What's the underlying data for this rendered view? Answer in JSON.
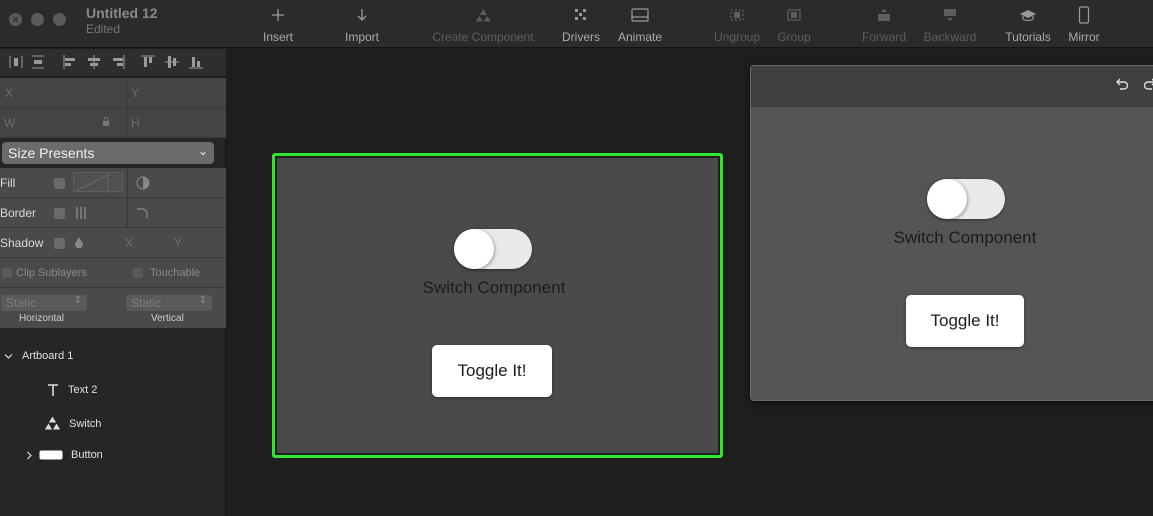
{
  "window": {
    "title": "Untitled 12",
    "status": "Edited"
  },
  "toolbar": {
    "insert": "Insert",
    "import": "Import",
    "create_component": "Create Component",
    "drivers": "Drivers",
    "animate": "Animate",
    "ungroup": "Ungroup",
    "group": "Group",
    "forward": "Forward",
    "backward": "Backward",
    "tutorials": "Tutorials",
    "mirror": "Mirror"
  },
  "inspector": {
    "x_placeholder": "X",
    "y_placeholder": "Y",
    "w_placeholder": "W",
    "h_placeholder": "H",
    "size_presets": "Size Presents",
    "fill_label": "Fill",
    "border_label": "Border",
    "shadow_label": "Shadow",
    "shadow_x": "X",
    "shadow_y": "Y",
    "clip_sublayers": "Clip Sublayers",
    "touchable": "Touchable",
    "horizontal_value": "Static",
    "vertical_value": "Static",
    "horizontal_caption": "Horizontal",
    "vertical_caption": "Vertical"
  },
  "layers": {
    "artboard": "Artboard 1",
    "items": [
      {
        "name": "Text 2",
        "icon": "text-icon"
      },
      {
        "name": "Switch",
        "icon": "component-icon"
      },
      {
        "name": "Button",
        "icon": "rectangle-icon"
      }
    ]
  },
  "artboard": {
    "switch_label": "Switch Component",
    "button_label": "Toggle It!",
    "selection_color": "#2fe52f"
  },
  "preview": {
    "switch_label": "Switch Component",
    "button_label": "Toggle It!"
  }
}
